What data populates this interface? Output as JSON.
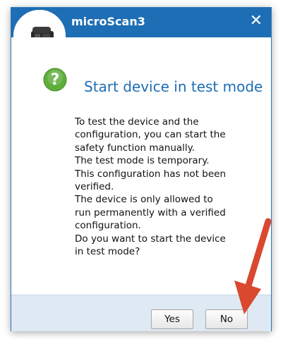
{
  "window": {
    "title": "microScan3",
    "close_glyph": "✕"
  },
  "dialog": {
    "icon": "question-mark-icon",
    "heading": "Start device in test mode",
    "message": "To test the device and the configuration, you can start the safety function manually.\n The test mode is temporary. This configuration has not been verified.\n The device is only allowed to run permanently with a verified configuration.\n Do you want to start the device in test mode?"
  },
  "buttons": {
    "yes_label": "Yes",
    "no_label": "No"
  },
  "colors": {
    "titlebar": "#1d6eb4",
    "accent": "#1d6eb4",
    "footer": "#dfe9f3",
    "question_icon": "#5fae3a",
    "annotation_arrow": "#d9482f"
  }
}
